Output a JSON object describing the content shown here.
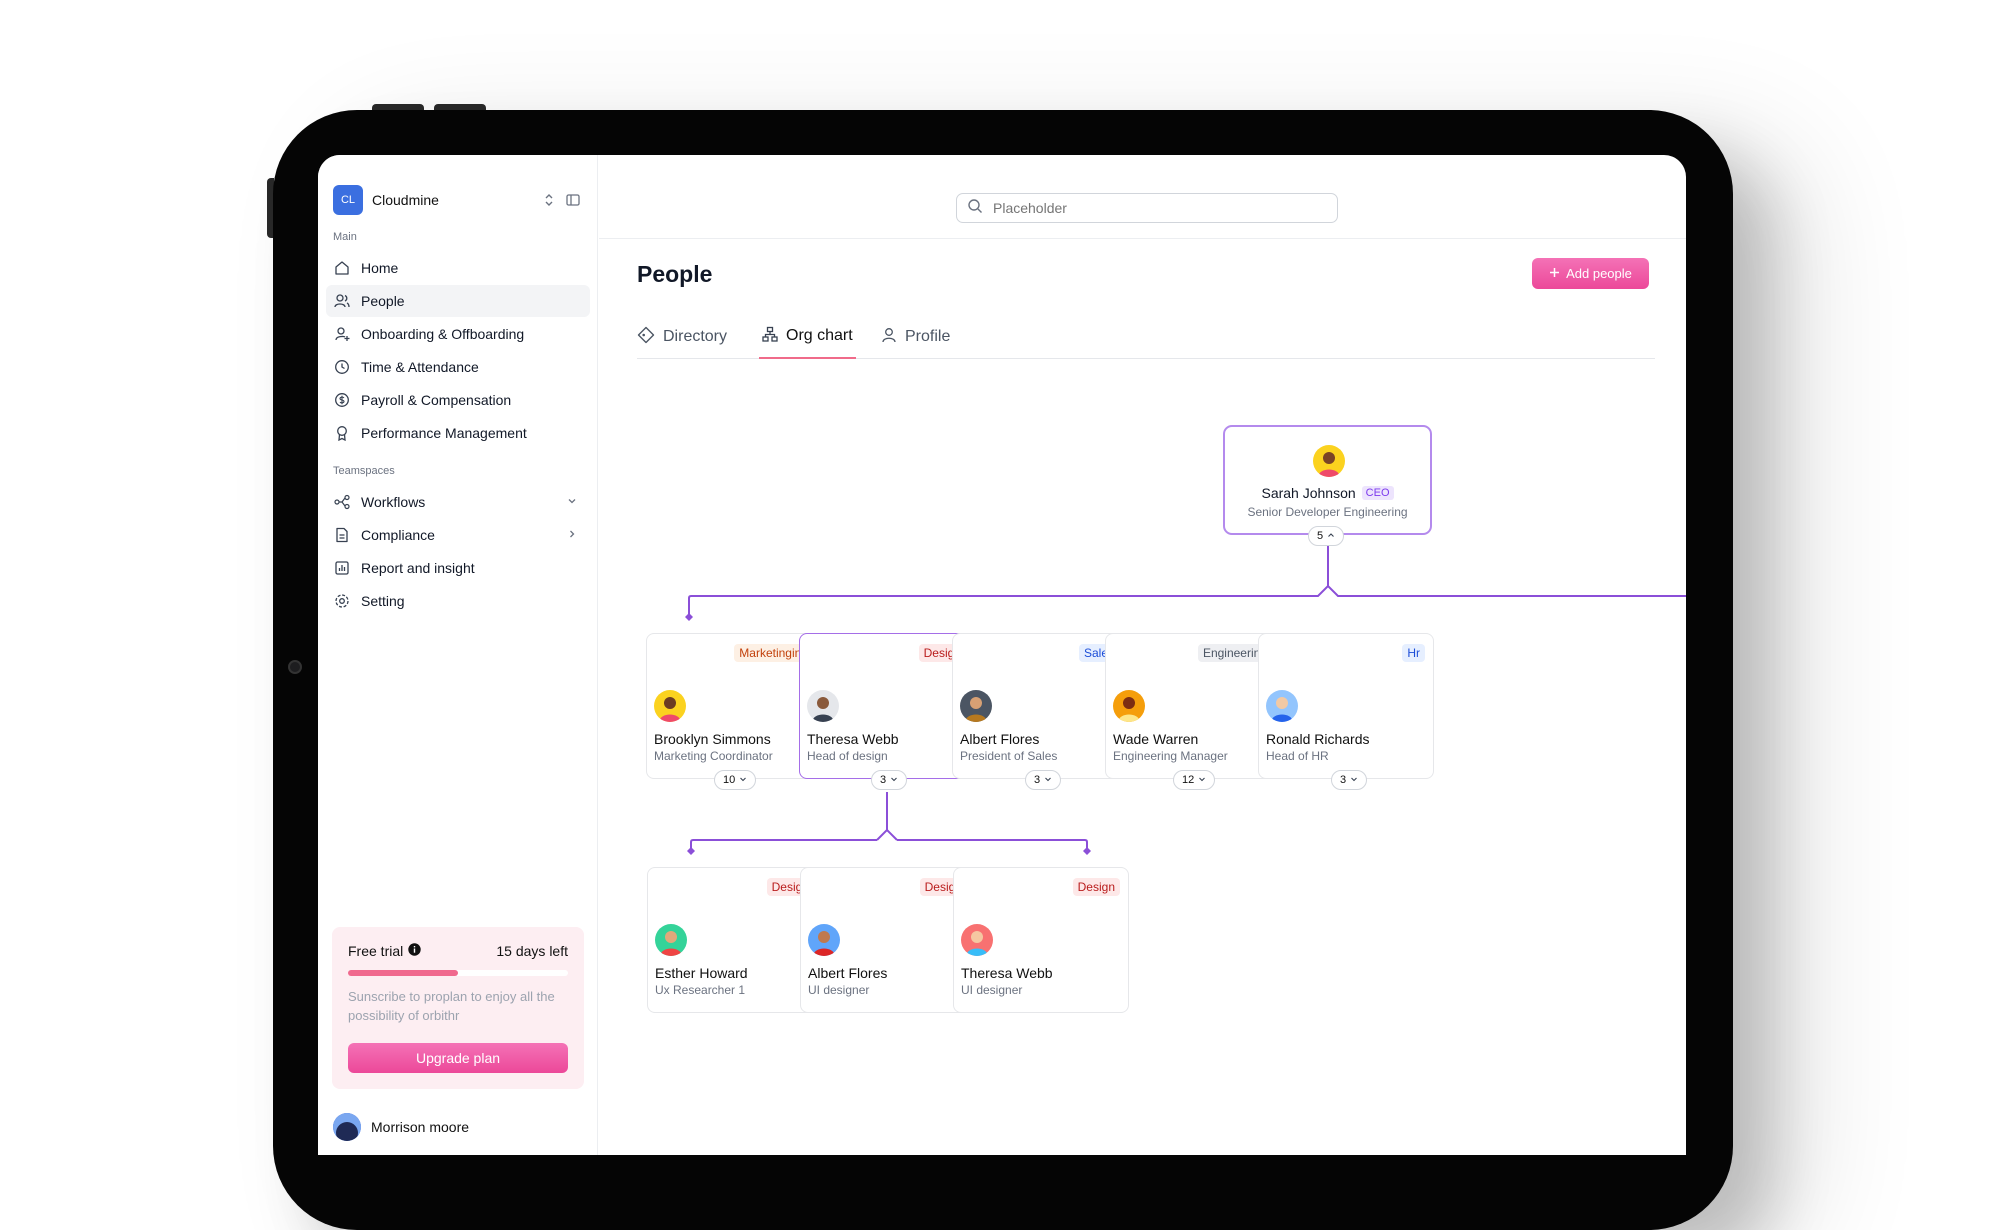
{
  "brand": {
    "logo_text": "CL",
    "name": "Cloudmine"
  },
  "sidebar": {
    "main_label": "Main",
    "main_items": [
      {
        "label": "Home",
        "icon": "home-icon"
      },
      {
        "label": "People",
        "icon": "people-icon",
        "active": true
      },
      {
        "label": "Onboarding & Offboarding",
        "icon": "user-plus-icon"
      },
      {
        "label": "Time & Attendance",
        "icon": "clock-icon"
      },
      {
        "label": "Payroll & Compensation",
        "icon": "dollar-icon"
      },
      {
        "label": "Performance Management",
        "icon": "award-icon"
      }
    ],
    "teamspaces_label": "Teamspaces",
    "teamspace_items": [
      {
        "label": "Workflows",
        "icon": "workflow-icon",
        "chevron": "down"
      },
      {
        "label": "Compliance",
        "icon": "document-icon",
        "chevron": "right"
      },
      {
        "label": "Report and insight",
        "icon": "chart-icon"
      },
      {
        "label": "Setting",
        "icon": "gear-icon"
      }
    ],
    "trial": {
      "title": "Free trial",
      "days_left": "15 days left",
      "progress": 0.5,
      "description": "Sunscribe to proplan to enjoy all the possibility of orbithr",
      "upgrade_label": "Upgrade plan"
    },
    "user": {
      "name": "Morrison moore"
    }
  },
  "search": {
    "placeholder": "Placeholder"
  },
  "page": {
    "title": "People",
    "add_label": "Add people"
  },
  "tabs": [
    {
      "label": "Directory",
      "icon": "tag-icon"
    },
    {
      "label": "Org chart",
      "icon": "org-chart-icon",
      "active": true
    },
    {
      "label": "Profile",
      "icon": "user-icon"
    }
  ],
  "org": {
    "ceo": {
      "name": "Sarah Johnson",
      "badge": "CEO",
      "role": "Senior Developer Engineering",
      "count": "5"
    },
    "level1": [
      {
        "tag": "Marketinging",
        "name": "Brooklyn Simmons",
        "role": "Marketing Coordinator",
        "count": "10"
      },
      {
        "tag": "Design",
        "name": "Theresa Webb",
        "role": "Head of design",
        "count": "3"
      },
      {
        "tag": "Sales",
        "name": "Albert Flores",
        "role": "President of Sales",
        "count": "3"
      },
      {
        "tag": "Engineering",
        "name": "Wade Warren",
        "role": "Engineering Manager",
        "count": "12"
      },
      {
        "tag": "Hr",
        "name": "Ronald Richards",
        "role": "Head of HR",
        "count": "3"
      }
    ],
    "level2": [
      {
        "tag": "Design",
        "name": "Esther Howard",
        "role": "Ux Researcher 1"
      },
      {
        "tag": "Design",
        "name": "Albert Flores",
        "role": "UI designer"
      },
      {
        "tag": "Design",
        "name": "Theresa Webb",
        "role": "UI designer"
      }
    ]
  },
  "colors": {
    "accent": "#ec4899",
    "connector": "#8b4fd8",
    "tag_marketing_bg": "#fdf0e4",
    "tag_marketing_fg": "#c2410c",
    "tag_design_bg": "#fde8e8",
    "tag_design_fg": "#b91c1c",
    "tag_sales_bg": "#e6efff",
    "tag_sales_fg": "#1d4ed8",
    "tag_engineering_bg": "#eeeff2",
    "tag_engineering_fg": "#4b5563",
    "tag_hr_bg": "#e6efff",
    "tag_hr_fg": "#1d4ed8"
  }
}
